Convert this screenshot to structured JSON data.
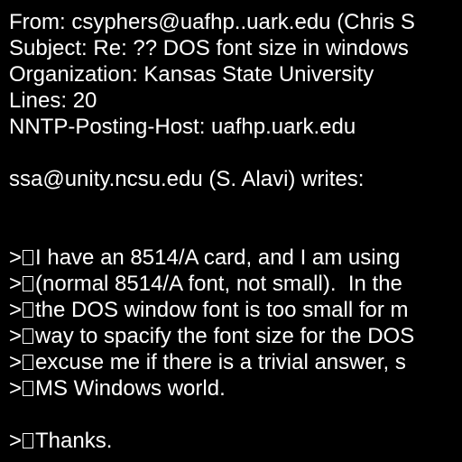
{
  "headers": {
    "from": "From: csyphers@uafhp..uark.edu (Chris S",
    "subject": "Subject: Re: ?? DOS font size in windows",
    "organization": "Organization: Kansas State University",
    "lines": "Lines: 20",
    "nntp_posting_host": "NNTP-Posting-Host: uafhp.uark.edu"
  },
  "attribution": "ssa@unity.ncsu.edu (S. Alavi) writes:",
  "quote_marker": ">",
  "quoted_lines": [
    "I have an 8514/A card, and I am using",
    "(normal 8514/A font, not small).  In the",
    "the DOS window font is too small for m",
    "way to spacify the font size for the DOS",
    "excuse me if there is a trivial answer, s",
    "MS Windows world."
  ],
  "closing": "Thanks.",
  "colors": {
    "background": "#000000",
    "text": "#ffffff"
  }
}
